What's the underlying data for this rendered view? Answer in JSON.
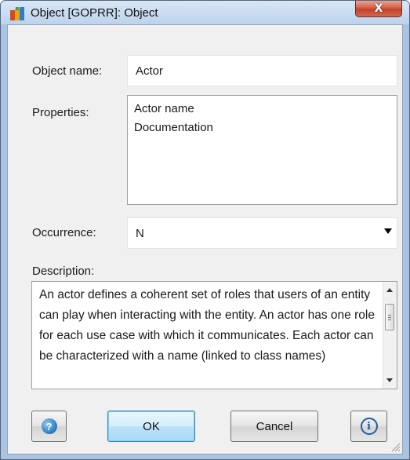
{
  "window": {
    "title": "Object [GOPRR]: Object",
    "close_glyph": "X",
    "icon": "metaedit-app-icon"
  },
  "form": {
    "object_name_label": "Object name:",
    "object_name_value": "Actor",
    "properties_label": "Properties:",
    "properties": [
      "Actor name",
      "Documentation"
    ],
    "occurrence_label": "Occurrence:",
    "occurrence_value": "N",
    "description_label": "Description:",
    "description_text": "An actor defines a coherent set of roles that users of an entity can play when interacting with the entity. An actor has one role for each use case with which it communicates. Each actor can be characterized with a name (linked to class names)"
  },
  "buttons": {
    "help_glyph": "?",
    "ok_label": "OK",
    "cancel_label": "Cancel",
    "info_glyph": "i"
  },
  "colors": {
    "titlebar": "#c7dbf1",
    "close_button": "#c94a35",
    "default_button": "#bde3f8",
    "client_background": "#f0f0f0"
  }
}
